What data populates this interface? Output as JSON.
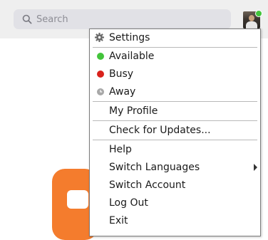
{
  "search": {
    "placeholder": "Search"
  },
  "colors": {
    "available": "#43c43b",
    "busy": "#d9221c",
    "away": "#a8a8a8",
    "brand": "#f47c2d"
  },
  "menu": {
    "settings": "Settings",
    "available": "Available",
    "busy": "Busy",
    "away": "Away",
    "my_profile": "My Profile",
    "check_updates": "Check for Updates...",
    "help": "Help",
    "switch_languages": "Switch Languages",
    "switch_account": "Switch Account",
    "log_out": "Log Out",
    "exit": "Exit"
  }
}
